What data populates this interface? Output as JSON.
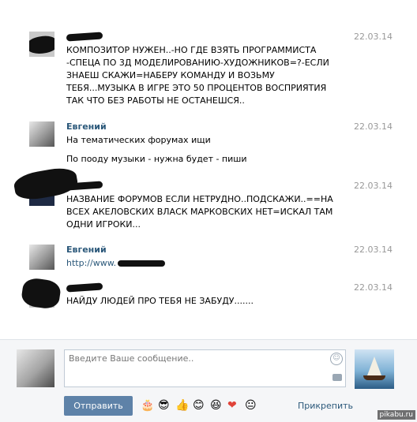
{
  "messages": [
    {
      "author": "",
      "date": "22.03.14",
      "lines": [
        "КОМПОЗИТОР НУЖЕН..-НО ГДЕ ВЗЯТЬ ПРОГРАММИСТА -СПЕЦА ПО 3Д МОДЕЛИРОВАНИЮ-ХУДОЖНИКОВ=?-ЕСЛИ ЗНАЕШ СКАЖИ=НАБЕРУ КОМАНДУ И ВОЗЬМУ ТЕБЯ...МУЗЫКА В ИГРЕ ЭТО 50 ПРОЦЕНТОВ ВОСПРИЯТИЯ ТАК ЧТО БЕЗ РАБОТЫ НЕ ОСТАНЕШСЯ.."
      ]
    },
    {
      "author": "Евгений",
      "date": "22.03.14",
      "lines": [
        "На тематических форумах ищи",
        "По пооду музыки - нужна будет - пиши"
      ]
    },
    {
      "author": "",
      "date": "22.03.14",
      "lines": [
        "НАЗВАНИЕ ФОРУМОВ ЕСЛИ НЕТРУДНО..ПОДСКАЖИ..==НА ВСЕХ АКЕЛОВСКИХ ВЛАСК МАРКОВСКИХ НЕТ=ИСКАЛ ТАМ ОДНИ ИГРОКИ..."
      ]
    },
    {
      "author": "Евгений",
      "date": "22.03.14",
      "lines": [
        "http://www."
      ]
    },
    {
      "author": "",
      "date": "22.03.14",
      "lines": [
        "НАЙДУ ЛЮДЕЙ ПРО ТЕБЯ НЕ ЗАБУДУ......."
      ]
    }
  ],
  "composer": {
    "placeholder": "Введите Ваше сообщение..",
    "send_label": "Отправить",
    "attach_label": "Прикрепить",
    "emojis": [
      "🎂",
      "😎",
      "👍",
      "😊",
      "😆",
      "❤",
      "😐"
    ]
  },
  "watermark": "pikabu.ru"
}
